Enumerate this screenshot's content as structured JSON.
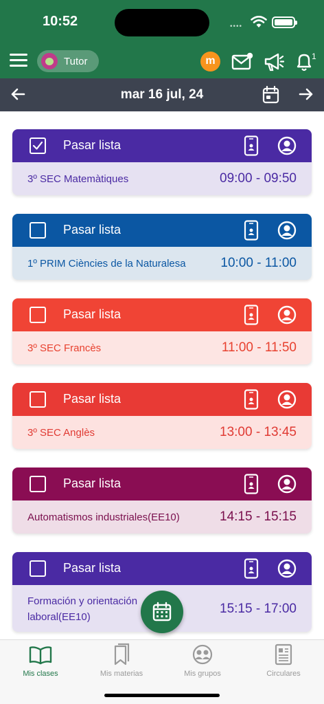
{
  "status": {
    "time": "10:52",
    "battery_level": 1.0
  },
  "header": {
    "role_chip": "Tutor",
    "icons": [
      "menu-icon",
      "moodle-icon",
      "mail-icon",
      "megaphone-icon",
      "bell-icon"
    ],
    "moodle_glyph": "m",
    "bell_badge": "1"
  },
  "date_nav": {
    "date": "mar 16 jul, 24"
  },
  "cards": [
    {
      "title": "Pasar lista",
      "subject": "3º SEC Matemàtiques",
      "time": "09:00 - 09:50",
      "checked": true,
      "head_color": "#4a2aa3",
      "body_color": "#e6e1f2",
      "text_color": "#4a2aa3"
    },
    {
      "title": "Pasar lista",
      "subject": "1º PRIM Ciències de la Naturalesa",
      "time": "10:00 - 11:00",
      "checked": false,
      "head_color": "#0b57a3",
      "body_color": "#dce6ef",
      "text_color": "#0b57a3"
    },
    {
      "title": "Pasar lista",
      "subject": "3º SEC Francès",
      "time": "11:00 - 11:50",
      "checked": false,
      "head_color": "#f04435",
      "body_color": "#fde5e3",
      "text_color": "#e8412f"
    },
    {
      "title": "Pasar lista",
      "subject": "3º SEC Anglès",
      "time": "13:00 - 13:45",
      "checked": false,
      "head_color": "#e83a35",
      "body_color": "#fde2e0",
      "text_color": "#e03a33"
    },
    {
      "title": "Pasar lista",
      "subject": "Automatismos industriales(EE10)",
      "time": "14:15 - 15:15",
      "checked": false,
      "head_color": "#8a0d53",
      "body_color": "#efdde7",
      "text_color": "#7a0f4d"
    },
    {
      "title": "Pasar lista",
      "subject_line1": "Formación y orientación",
      "subject_line2": "laboral(EE10)",
      "time": "15:15 - 17:00",
      "checked": false,
      "head_color": "#4a2aa3",
      "body_color": "#e6e1f2",
      "text_color": "#4a2aa3"
    }
  ],
  "bottom_nav": [
    {
      "label": "Mis clases",
      "icon": "book-open-icon",
      "active": true
    },
    {
      "label": "Mis materias",
      "icon": "bookmark-icon",
      "active": false
    },
    {
      "label": "Mis grupos",
      "icon": "group-icon",
      "active": false
    },
    {
      "label": "Circulares",
      "icon": "newspaper-icon",
      "active": false
    }
  ],
  "colors": {
    "brand": "#22774a",
    "date_bar": "#3d4350",
    "inactive_tab": "#9a9a9a"
  }
}
